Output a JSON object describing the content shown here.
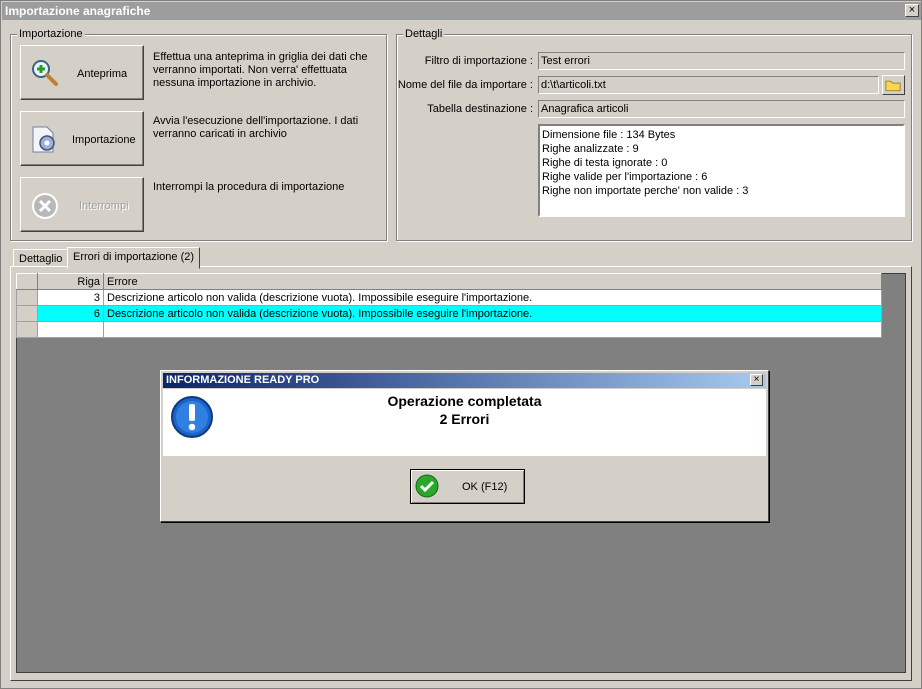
{
  "window": {
    "title": "Importazione anagrafiche",
    "close_glyph": "×"
  },
  "import_group": {
    "label": "Importazione",
    "buttons": [
      {
        "label": "Anteprima",
        "description": "Effettua una anteprima in griglia dei dati che verranno importati. Non verra' effettuata nessuna importazione in archivio.",
        "icon": "magnifier-plus-icon",
        "enabled": true
      },
      {
        "label": "Importazione",
        "description": "Avvia l'esecuzione dell'importazione. I dati verranno caricati in archivio",
        "icon": "gear-document-icon",
        "enabled": true
      },
      {
        "label": "Interrompi",
        "description": "Interrompi la procedura di importazione",
        "icon": "stop-x-icon",
        "enabled": false
      }
    ]
  },
  "details_group": {
    "label": "Dettagli",
    "filter_label": "Filtro di importazione :",
    "filter_value": "Test errori",
    "file_label": "Nome del file da importare :",
    "file_value": "d:\\t\\articoli.txt",
    "table_label": "Tabella destinazione :",
    "table_value": "Anagrafica articoli",
    "info_lines": [
      "Dimensione file : 134 Bytes",
      "Righe analizzate : 9",
      "Righe di testa ignorate : 0",
      "Righe valide per l'importazione : 6",
      "Righe non importate perche' non valide : 3"
    ]
  },
  "tabs": [
    {
      "label": "Dettaglio",
      "active": false
    },
    {
      "label": "Errori di importazione (2)",
      "active": true
    }
  ],
  "grid": {
    "columns": [
      "Riga",
      "Errore"
    ],
    "rows": [
      {
        "riga": "3",
        "errore": "Descrizione articolo non valida (descrizione vuota). Impossibile eseguire l'importazione.",
        "selected": false
      },
      {
        "riga": "6",
        "errore": "Descrizione articolo non valida (descrizione vuota). Impossibile eseguire l'importazione.",
        "selected": true
      }
    ]
  },
  "dialog": {
    "title": "INFORMAZIONE READY PRO",
    "line1": "Operazione completata",
    "line2": "2 Errori",
    "ok_label": "OK (F12)",
    "close_glyph": "×"
  },
  "colors": {
    "selected_row": "#00ffff",
    "dialog_title_start": "#0a246a",
    "dialog_title_end": "#a6caf0",
    "titlebar": "#9d9d9d"
  }
}
